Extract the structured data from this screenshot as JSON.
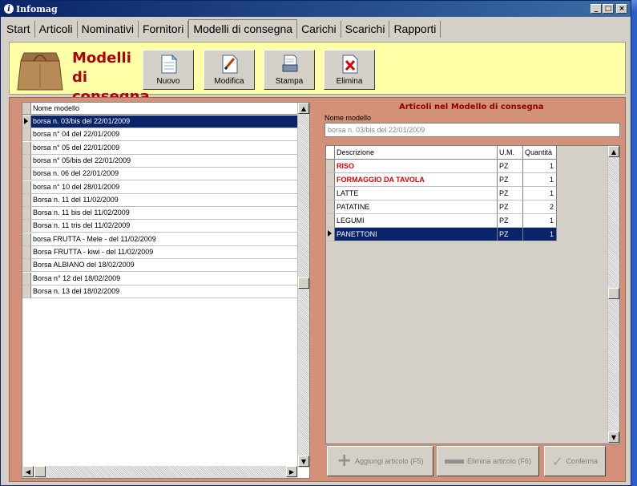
{
  "window": {
    "title": "Infomag",
    "min_glyph": "_",
    "max_glyph": "□",
    "close_glyph": "×"
  },
  "tabs": [
    {
      "label": "Start"
    },
    {
      "label": "Articoli"
    },
    {
      "label": "Nominativi"
    },
    {
      "label": "Fornitori"
    },
    {
      "label": "Modelli di consegna",
      "active": true
    },
    {
      "label": "Carichi"
    },
    {
      "label": "Scarichi"
    },
    {
      "label": "Rapporti"
    }
  ],
  "banner": {
    "title_line1": "Modelli di",
    "title_line2": "consegna",
    "buttons": {
      "nuovo": "Nuovo",
      "modifica": "Modifica",
      "stampa": "Stampa",
      "elimina": "Elimina"
    }
  },
  "model_list": {
    "header": "Nome modello",
    "rows": [
      "borsa n. 03/bis del 22/01/2009",
      "borsa n° 04 del 22/01/2009",
      "borsa n° 05 del 22/01/2009",
      "borsa n° 05/bis del 22/01/2009",
      "borsa n. 06 del 22/01/2009",
      "borsa n° 10 del 28/01/2009",
      "Borsa n. 11 del 11/02/2009",
      "Borsa n. 11 bis del 11/02/2009",
      "Borsa n. 11 tris del 11/02/2009",
      "borsa FRUTTA -  Mele -     del 11/02/2009",
      "Borsa FRUTTA - kiwi -  del 11/02/2009",
      "Borsa ALBIANO del 18/02/2009",
      "Borsa n° 12 del 18/02/2009",
      "Borsa n. 13 del 18/02/2009"
    ],
    "selected_index": 0
  },
  "detail": {
    "title": "Articoli nel Modello di consegna",
    "name_label": "Nome modello",
    "name_value": "borsa n. 03/bis del 22/01/2009",
    "columns": {
      "desc": "Descrizione",
      "um": "U.M.",
      "qty": "Quantità"
    },
    "items": [
      {
        "desc": "RISO",
        "um": "PZ",
        "qty": "1",
        "highlight": true
      },
      {
        "desc": "FORMAGGIO DA TAVOLA",
        "um": "PZ",
        "qty": "1",
        "highlight": true
      },
      {
        "desc": "LATTE",
        "um": "PZ",
        "qty": "1",
        "highlight": false
      },
      {
        "desc": "PATATINE",
        "um": "PZ",
        "qty": "2",
        "highlight": false
      },
      {
        "desc": "LEGUMI",
        "um": "PZ",
        "qty": "1",
        "highlight": false
      },
      {
        "desc": "PANETTONI",
        "um": "PZ",
        "qty": "1",
        "highlight": false
      }
    ],
    "selected_index": 5,
    "highlight_color": "#e00000",
    "selection_color": "#0a246a"
  },
  "actions": {
    "add": "Aggiungi articolo (F5)",
    "remove": "Elimina articolo (F6)",
    "confirm": "Conferma"
  },
  "colors": {
    "banner_bg": "#ffffa8",
    "content_bg": "#d4917a",
    "title_red": "#b00000"
  }
}
